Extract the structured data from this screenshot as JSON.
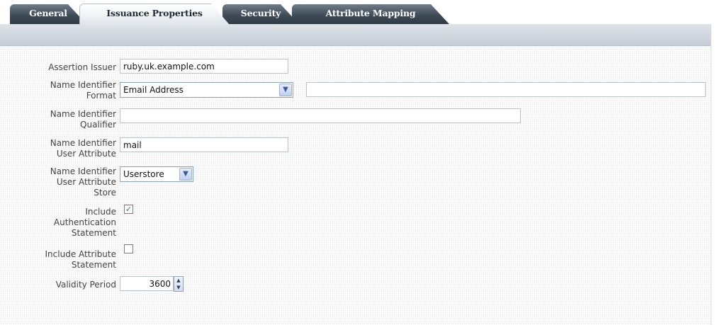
{
  "tabs": [
    {
      "label": "General",
      "active": false
    },
    {
      "label": "Issuance Properties",
      "active": true
    },
    {
      "label": "Security",
      "active": false
    },
    {
      "label": "Attribute Mapping",
      "active": false
    }
  ],
  "form": {
    "assertion_issuer": {
      "label": "Assertion Issuer",
      "value": "ruby.uk.example.com"
    },
    "name_id_format": {
      "label_line1": "Name Identifier",
      "label_line2": "Format",
      "selected": "Email Address",
      "extra_value": ""
    },
    "name_id_qualifier": {
      "label_line1": "Name Identifier",
      "label_line2": "Qualifier",
      "value": ""
    },
    "name_id_user_attribute": {
      "label_line1": "Name Identifier",
      "label_line2": "User Attribute",
      "value": "mail"
    },
    "name_id_user_attribute_store": {
      "label_line1": "Name Identifier",
      "label_line2": "User Attribute",
      "label_line3": "Store",
      "selected": "Userstore"
    },
    "include_auth_statement": {
      "label_line1": "Include",
      "label_line2": "Authentication",
      "label_line3": "Statement",
      "checked": true
    },
    "include_attribute_statement": {
      "label_line1": "Include Attribute",
      "label_line2": "Statement",
      "checked": false
    },
    "validity_period": {
      "label": "Validity Period",
      "value": "3600"
    }
  },
  "icons": {
    "dropdown": "chevron-down-icon",
    "check": "checkmark-icon",
    "spinner": "spinner-arrows-icon"
  },
  "colors": {
    "tab_dark": "#3f4b57",
    "tab_active": "#ffffff",
    "band": "#cfd6dd",
    "check": "#1f8a20"
  }
}
